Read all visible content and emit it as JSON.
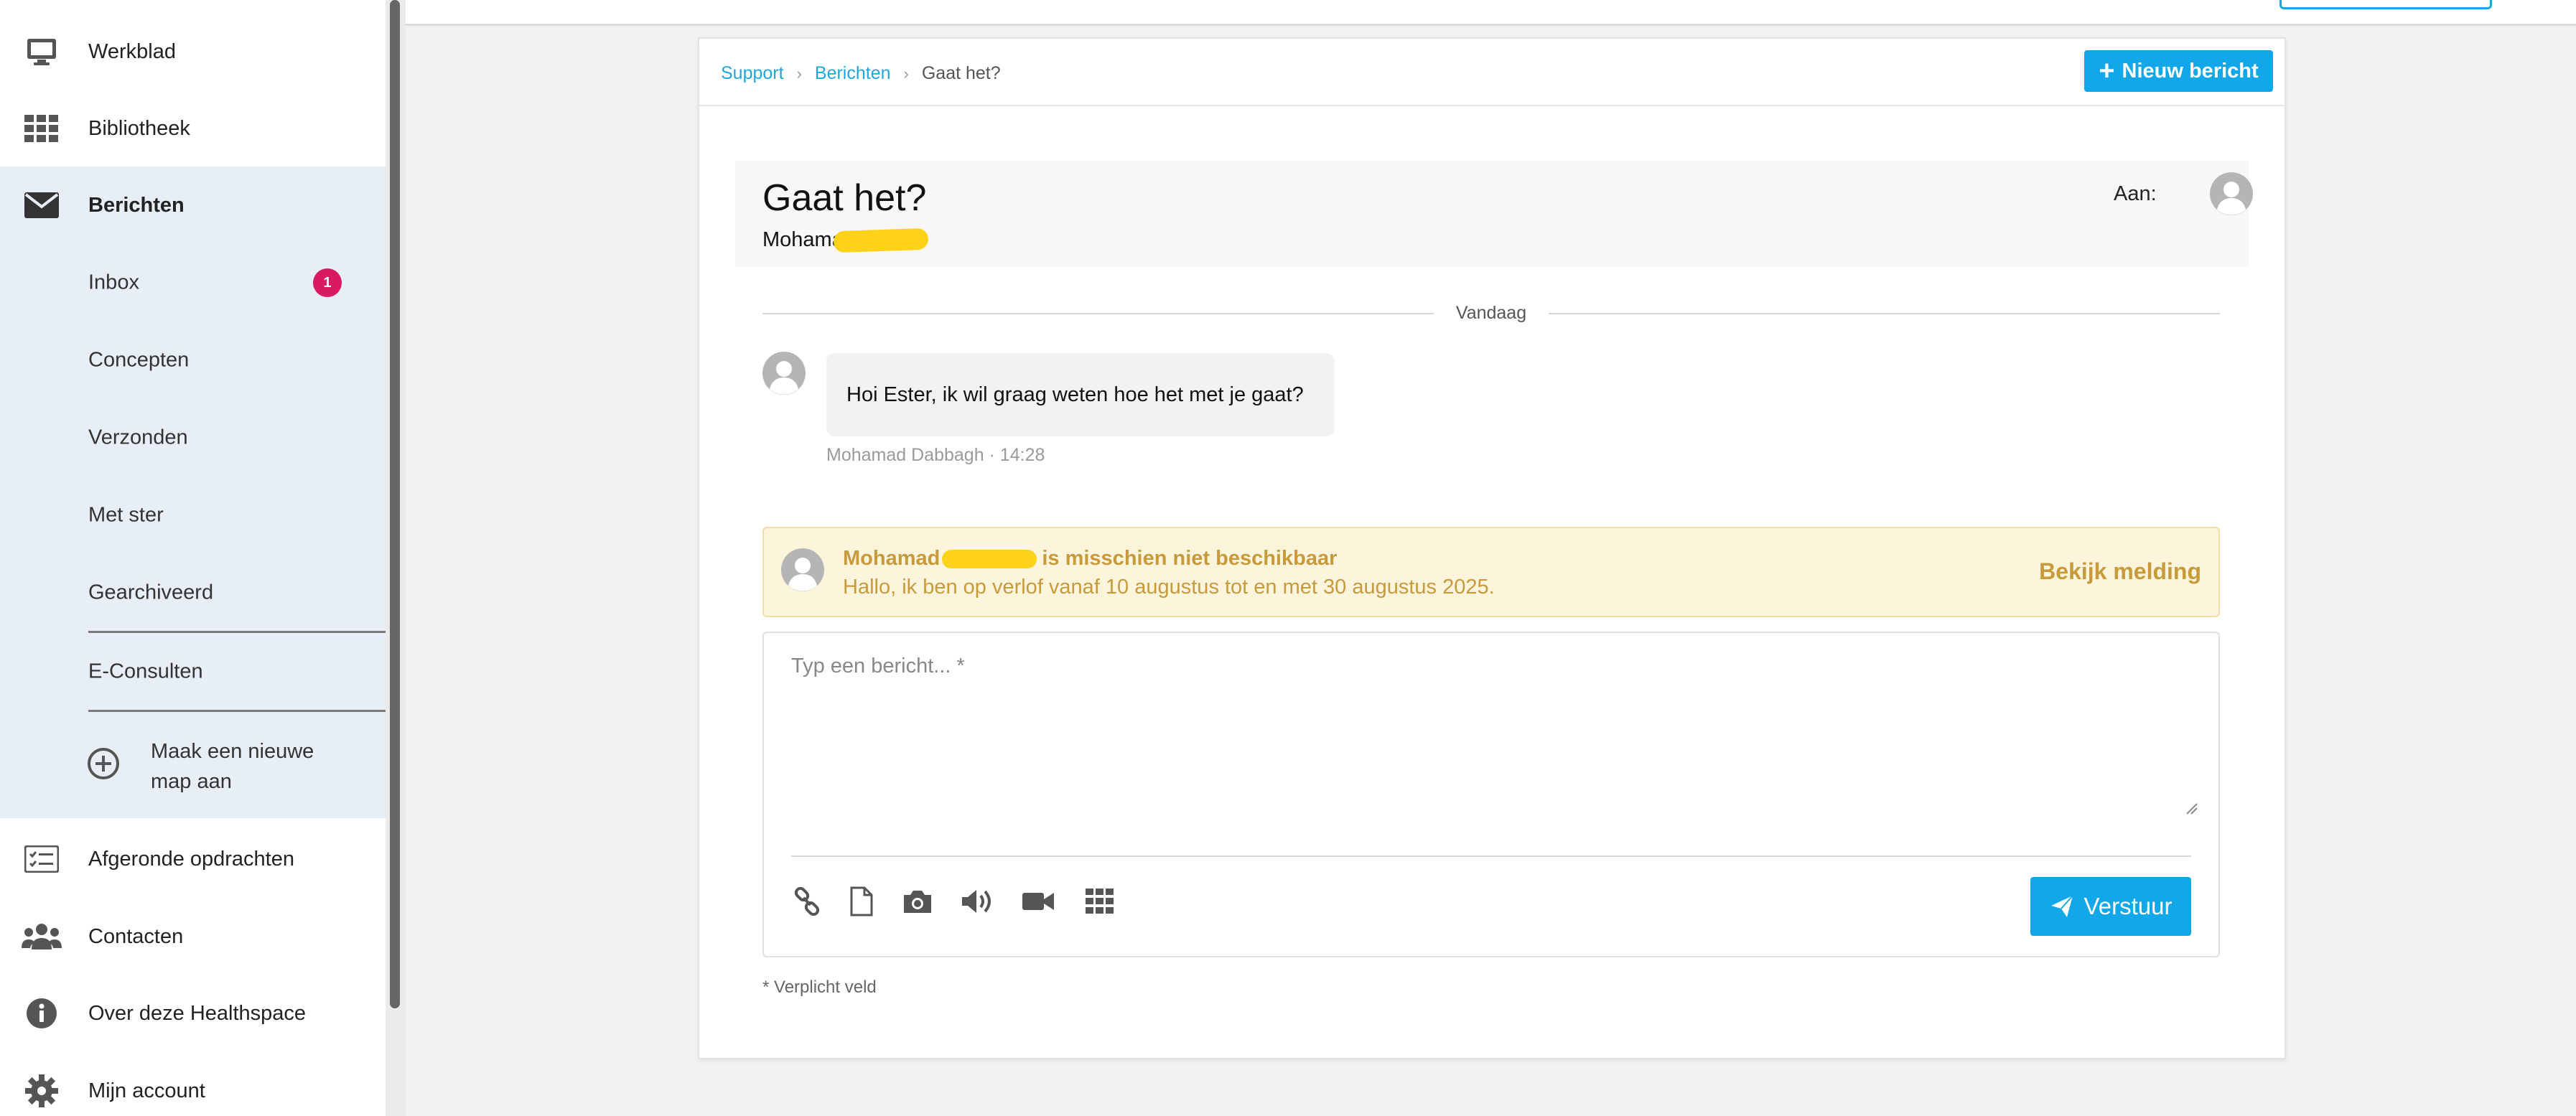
{
  "sidebar": {
    "items": [
      {
        "label": "Werkblad",
        "icon": "monitor-icon"
      },
      {
        "label": "Bibliotheek",
        "icon": "grid-icon"
      },
      {
        "label": "Berichten",
        "icon": "envelope-icon"
      },
      {
        "label": "Afgeronde opdrachten",
        "icon": "checklist-icon"
      },
      {
        "label": "Contacten",
        "icon": "users-icon"
      },
      {
        "label": "Over deze Healthspace",
        "icon": "info-icon"
      },
      {
        "label": "Mijn account",
        "icon": "gear-icon"
      }
    ],
    "messages_submenu": [
      {
        "label": "Inbox",
        "badge": "1"
      },
      {
        "label": "Concepten"
      },
      {
        "label": "Verzonden"
      },
      {
        "label": "Met ster"
      },
      {
        "label": "Gearchiveerd"
      },
      {
        "label": "E-Consulten"
      }
    ],
    "new_folder_label_line1": "Maak een nieuwe",
    "new_folder_label_line2": "map aan"
  },
  "breadcrumb": {
    "items": [
      "Support",
      "Berichten",
      "Gaat het?"
    ]
  },
  "header": {
    "new_message_label": "Nieuw bericht"
  },
  "conversation": {
    "subject": "Gaat het?",
    "from": "Mohamad",
    "to_label": "Aan:",
    "day_label": "Vandaag",
    "message_text": "Hoi Ester, ik wil graag weten hoe het met je gaat?",
    "message_meta": "Mohamad Dabbagh · 14:28"
  },
  "away_notice": {
    "name": "Mohamad",
    "title_suffix": "is misschien niet beschikbaar",
    "text": "Hallo, ik ben op verlof vanaf 10 augustus tot en met 30 augustus 2025.",
    "view_label": "Bekijk melding"
  },
  "composer": {
    "placeholder": "Typ een bericht... *",
    "send_label": "Verstuur",
    "required_note": "* Verplicht veld",
    "tools": [
      "link-icon",
      "file-icon",
      "camera-icon",
      "audio-icon",
      "video-icon",
      "apps-grid-icon"
    ]
  },
  "colors": {
    "accent": "#12a7e8",
    "badge": "#d81b60",
    "notice_text": "#c79a3c",
    "notice_bg": "#fdf4dc",
    "active_group_bg": "#e7eef6"
  }
}
